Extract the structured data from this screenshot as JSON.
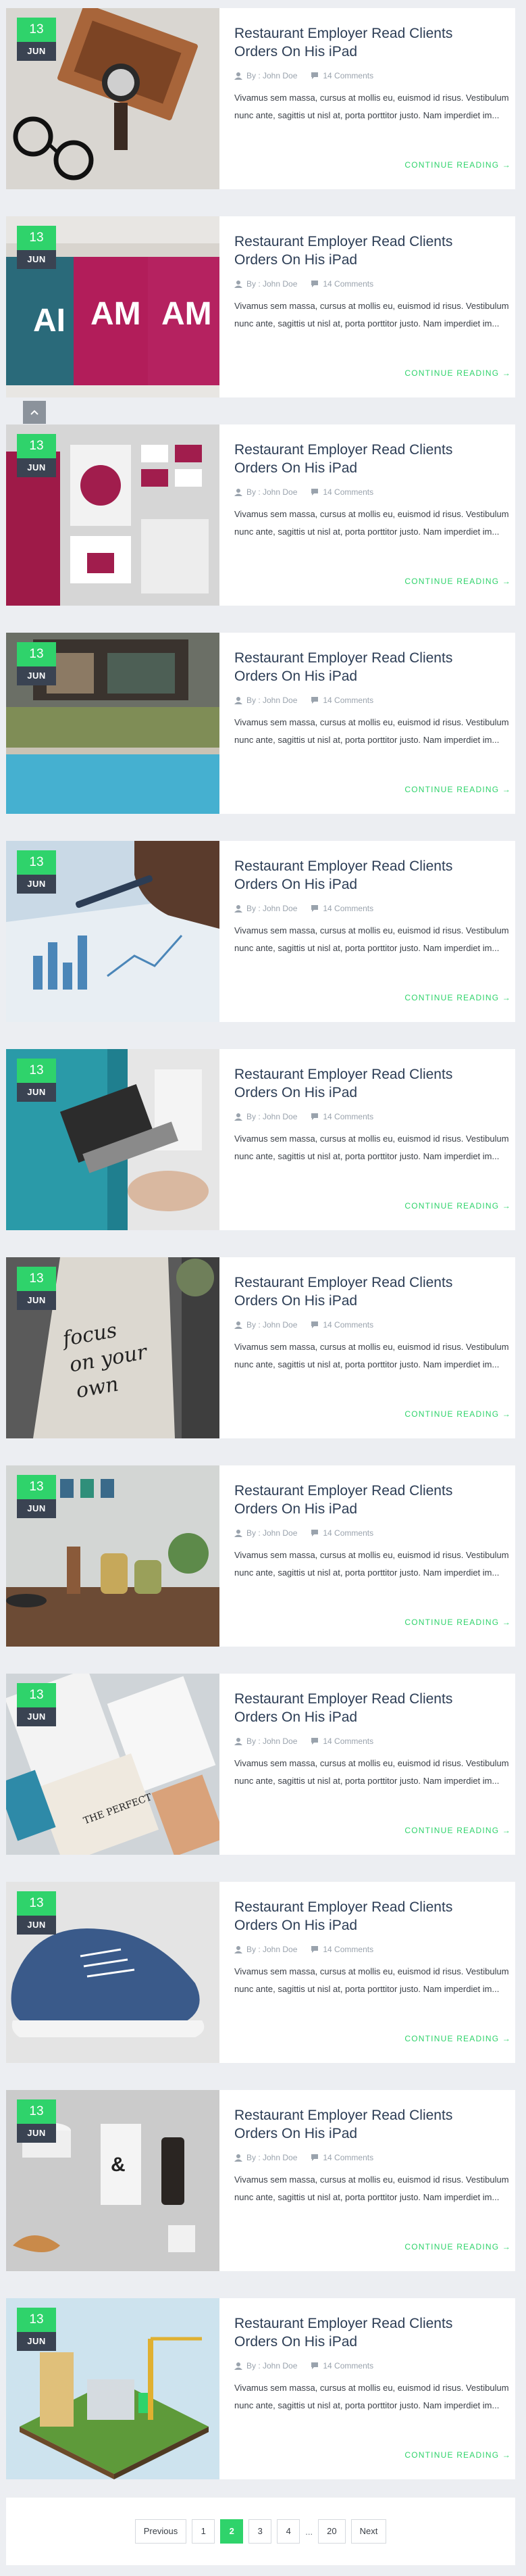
{
  "posts": [
    {
      "day": "13",
      "month": "JUN",
      "title": "Restaurant Employer Read Clients Orders On His iPad",
      "author": "By : John Doe",
      "comments": "14 Comments",
      "excerpt": "Vivamus sem massa, cursus at mollis eu, euismod id risus. Vestibulum nunc ante, sagittis ut nisl at, porta porttitor justo. Nam imperdiet im...",
      "read_more": "CONTINUE READING →",
      "image": "watch-and-glasses-in-box"
    },
    {
      "day": "13",
      "month": "JUN",
      "title": "Restaurant Employer Read Clients Orders On His iPad",
      "author": "By : John Doe",
      "comments": "14 Comments",
      "excerpt": "Vivamus sem massa, cursus at mollis eu, euismod id risus. Vestibulum nunc ante, sagittis ut nisl at, porta porttitor justo. Nam imperdiet im...",
      "read_more": "CONTINUE READING →",
      "image": "coffee-cups"
    },
    {
      "day": "13",
      "month": "JUN",
      "title": "Restaurant Employer Read Clients Orders On His iPad",
      "author": "By : John Doe",
      "comments": "14 Comments",
      "excerpt": "Vivamus sem massa, cursus at mollis eu, euismod id risus. Vestibulum nunc ante, sagittis ut nisl at, porta porttitor justo. Nam imperdiet im...",
      "read_more": "CONTINUE READING →",
      "image": "branding-stationery"
    },
    {
      "day": "13",
      "month": "JUN",
      "title": "Restaurant Employer Read Clients Orders On His iPad",
      "author": "By : John Doe",
      "comments": "14 Comments",
      "excerpt": "Vivamus sem massa, cursus at mollis eu, euismod id risus. Vestibulum nunc ante, sagittis ut nisl at, porta porttitor justo. Nam imperdiet im...",
      "read_more": "CONTINUE READING →",
      "image": "house-with-pool"
    },
    {
      "day": "13",
      "month": "JUN",
      "title": "Restaurant Employer Read Clients Orders On His iPad",
      "author": "By : John Doe",
      "comments": "14 Comments",
      "excerpt": "Vivamus sem massa, cursus at mollis eu, euismod id risus. Vestibulum nunc ante, sagittis ut nisl at, porta porttitor justo. Nam imperdiet im...",
      "read_more": "CONTINUE READING →",
      "image": "charts-and-hands"
    },
    {
      "day": "13",
      "month": "JUN",
      "title": "Restaurant Employer Read Clients Orders On His iPad",
      "author": "By : John Doe",
      "comments": "14 Comments",
      "excerpt": "Vivamus sem massa, cursus at mollis eu, euismod id risus. Vestibulum nunc ante, sagittis ut nisl at, porta porttitor justo. Nam imperdiet im...",
      "read_more": "CONTINUE READING →",
      "image": "laptop-by-pool"
    },
    {
      "day": "13",
      "month": "JUN",
      "title": "Restaurant Employer Read Clients Orders On His iPad",
      "author": "By : John Doe",
      "comments": "14 Comments",
      "excerpt": "Vivamus sem massa, cursus at mollis eu, euismod id risus. Vestibulum nunc ante, sagittis ut nisl at, porta porttitor justo. Nam imperdiet im...",
      "read_more": "CONTINUE READING →",
      "image": "tote-bag-lettering"
    },
    {
      "day": "13",
      "month": "JUN",
      "title": "Restaurant Employer Read Clients Orders On His iPad",
      "author": "By : John Doe",
      "comments": "14 Comments",
      "excerpt": "Vivamus sem massa, cursus at mollis eu, euismod id risus. Vestibulum nunc ante, sagittis ut nisl at, porta porttitor justo. Nam imperdiet im...",
      "read_more": "CONTINUE READING →",
      "image": "kitchen-shelf"
    },
    {
      "day": "13",
      "month": "JUN",
      "title": "Restaurant Employer Read Clients Orders On His iPad",
      "author": "By : John Doe",
      "comments": "14 Comments",
      "excerpt": "Vivamus sem massa, cursus at mollis eu, euismod id risus. Vestibulum nunc ante, sagittis ut nisl at, porta porttitor justo. Nam imperdiet im...",
      "read_more": "CONTINUE READING →",
      "image": "magazine-spreads"
    },
    {
      "day": "13",
      "month": "JUN",
      "title": "Restaurant Employer Read Clients Orders On His iPad",
      "author": "By : John Doe",
      "comments": "14 Comments",
      "excerpt": "Vivamus sem massa, cursus at mollis eu, euismod id risus. Vestibulum nunc ante, sagittis ut nisl at, porta porttitor justo. Nam imperdiet im...",
      "read_more": "CONTINUE READING →",
      "image": "blue-sneaker"
    },
    {
      "day": "13",
      "month": "JUN",
      "title": "Restaurant Employer Read Clients Orders On His iPad",
      "author": "By : John Doe",
      "comments": "14 Comments",
      "excerpt": "Vivamus sem massa, cursus at mollis eu, euismod id risus. Vestibulum nunc ante, sagittis ut nisl at, porta porttitor justo. Nam imperdiet im...",
      "read_more": "CONTINUE READING →",
      "image": "coffee-packaging"
    },
    {
      "day": "13",
      "month": "JUN",
      "title": "Restaurant Employer Read Clients Orders On His iPad",
      "author": "By : John Doe",
      "comments": "14 Comments",
      "excerpt": "Vivamus sem massa, cursus at mollis eu, euismod id risus. Vestibulum nunc ante, sagittis ut nisl at, porta porttitor justo. Nam imperdiet im...",
      "read_more": "CONTINUE READING →",
      "image": "isometric-city"
    }
  ],
  "pagination": {
    "previous": "Previous",
    "pages": [
      "1",
      "2",
      "3",
      "4"
    ],
    "active": "2",
    "ellipsis": "...",
    "last": "20",
    "next": "Next"
  },
  "colors": {
    "accent": "#2fd36b",
    "date_month_bg": "#3a4352",
    "title": "#2c3d55",
    "page_bg": "#eceef2"
  },
  "icons": {
    "scroll_top": "chevron-up-icon",
    "author": "user-icon",
    "comments": "comment-icon"
  }
}
